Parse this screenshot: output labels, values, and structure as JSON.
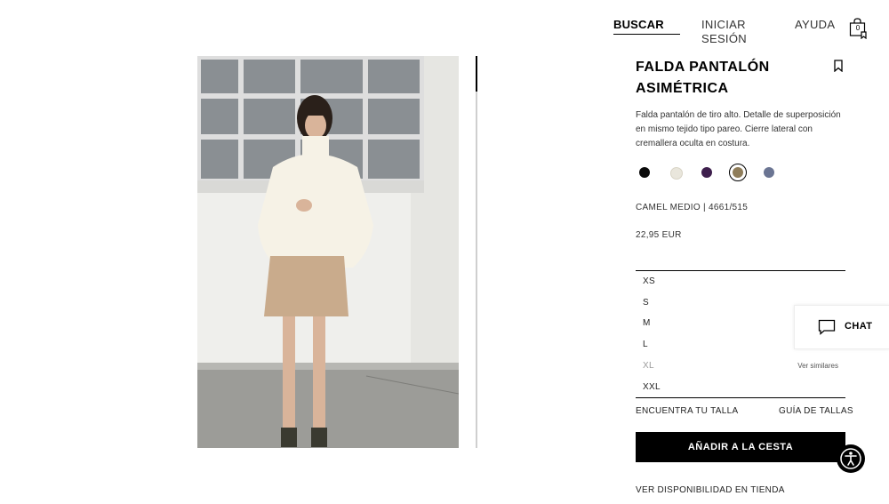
{
  "header": {
    "search_label": "BUSCAR",
    "login_label": "INICIAR SESIÓN",
    "help_label": "AYUDA",
    "cart_count": "0",
    "cart_icon": "shopping-bag-icon"
  },
  "product": {
    "title_line1": "FALDA PANTALÓN",
    "title_line2": "ASIMÉTRICA",
    "description": "Falda pantalón de tiro alto. Detalle de superposición en mismo tejido tipo pareo. Cierre lateral con cremallera oculta en costura.",
    "color_ref": "CAMEL MEDIO | 4661/515",
    "price": "22,95 EUR",
    "colors": [
      "#0a0a0a",
      "#e9e6dc",
      "#3e1f4d",
      "#8f7d5a",
      "#6b7593"
    ],
    "selected_color_index": 3
  },
  "sizes": [
    {
      "label": "XS",
      "available": true,
      "note": ""
    },
    {
      "label": "S",
      "available": true,
      "note": ""
    },
    {
      "label": "M",
      "available": true,
      "note": ""
    },
    {
      "label": "L",
      "available": true,
      "note": ""
    },
    {
      "label": "XL",
      "available": false,
      "note": "Ver similares"
    },
    {
      "label": "XXL",
      "available": true,
      "note": ""
    }
  ],
  "actions": {
    "find_size": "ENCUENTRA TU TALLA",
    "size_guide": "GUÍA DE TALLAS",
    "add_to_cart": "AÑADIR A LA CESTA",
    "store_availability": "VER DISPONIBILIDAD EN TIENDA"
  },
  "chat": {
    "label": "CHAT",
    "icon": "chat-bubble-icon"
  },
  "accessibility": {
    "icon": "accessibility-icon"
  },
  "colors": {
    "primary": "#000000",
    "background": "#ffffff",
    "muted_text": "#9a9a9a"
  }
}
